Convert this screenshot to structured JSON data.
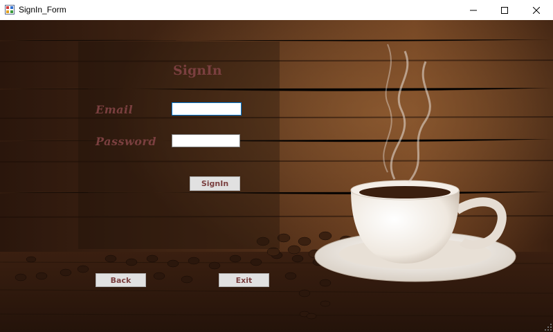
{
  "window": {
    "title": "SignIn_Form"
  },
  "form": {
    "heading": "SignIn",
    "email_label": "Email",
    "email_value": "",
    "password_label": "Password",
    "password_value": "",
    "signin_button": "SignIn",
    "back_button": "Back",
    "exit_button": "Exit"
  },
  "colors": {
    "label_color": "#7a3f3f",
    "panel_overlay": "rgba(30,18,10,0.35)",
    "focus_border": "#0078d7"
  },
  "icons": [
    "app-form-icon",
    "minimize-icon",
    "maximize-icon",
    "close-icon",
    "resize-grip-icon"
  ]
}
